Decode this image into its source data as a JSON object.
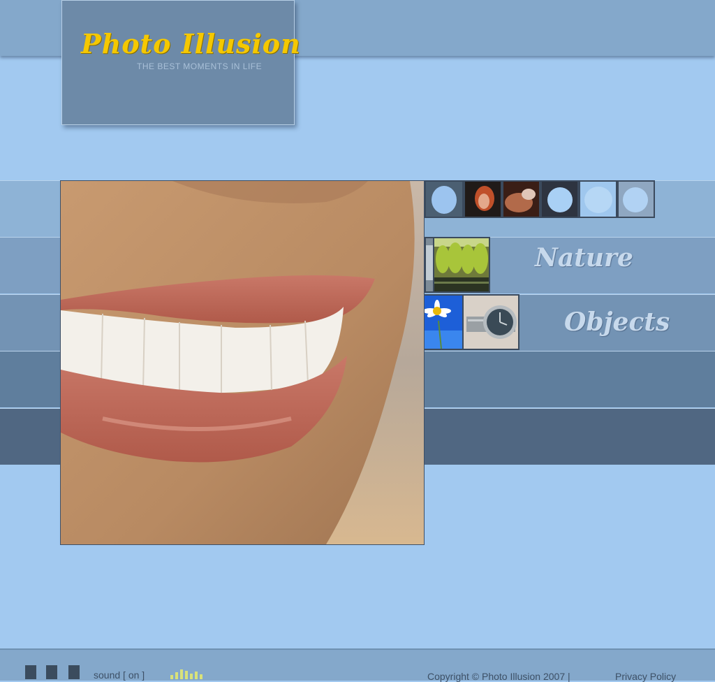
{
  "logo": {
    "title": "Photo Illusion",
    "tagline": "THE BEST MOMENTS IN LIFE"
  },
  "categories": [
    {
      "label": "Nature"
    },
    {
      "label": "Objects"
    }
  ],
  "footer": {
    "sound_label": "sound [ on ]",
    "copyright": "Copyright © Photo Illusion   2007 |",
    "privacy_label": "Privacy Policy"
  },
  "colors": {
    "background": "#a2c9f0",
    "logo_yellow": "#f5c800",
    "stripe_dark": "#506782"
  }
}
